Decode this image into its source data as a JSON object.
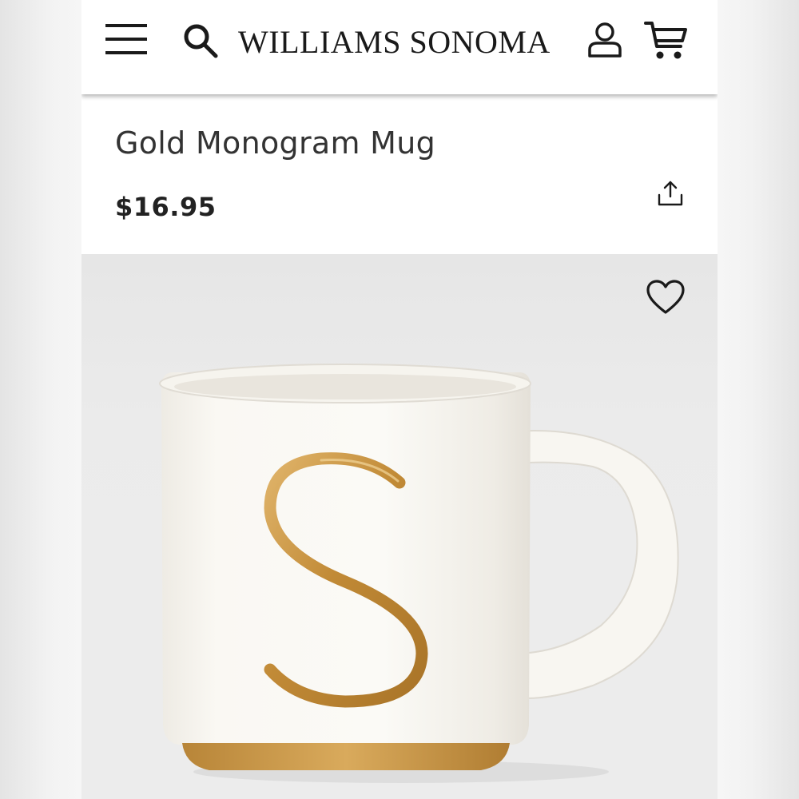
{
  "header": {
    "brand": "WILLIAMS SONOMA",
    "icons": {
      "menu": "hamburger-menu-icon",
      "search": "search-icon",
      "account": "account-icon",
      "cart": "cart-icon"
    }
  },
  "product": {
    "title": "Gold Monogram Mug",
    "price": "$16.95",
    "share_icon": "share-icon",
    "favorite_icon": "heart-icon",
    "image_alt": "White mug with gold letter S monogram",
    "monogram_letter": "S"
  },
  "colors": {
    "text_dark": "#1a1a1a",
    "gold": "#c9963e",
    "mug_white": "#f7f5f0",
    "image_bg": "#ececec"
  }
}
